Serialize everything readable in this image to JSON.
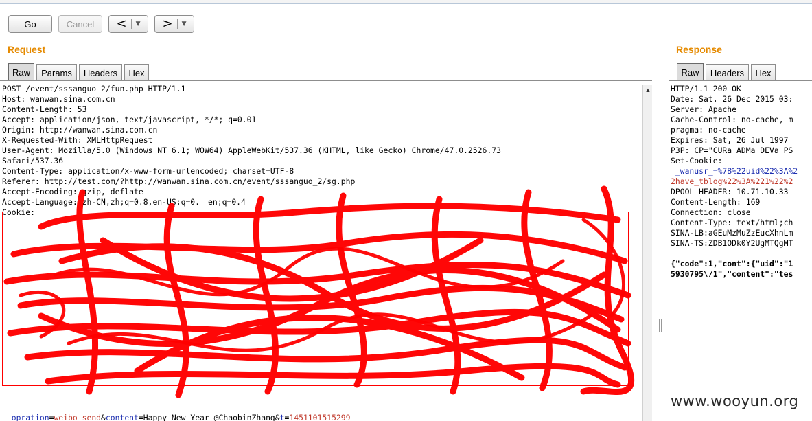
{
  "toolbar": {
    "go_label": "Go",
    "cancel_label": "Cancel",
    "back_arrow": "<",
    "forward_arrow": ">",
    "dropdown_glyph": "▼"
  },
  "request": {
    "title": "Request",
    "tabs": [
      "Raw",
      "Params",
      "Headers",
      "Hex"
    ],
    "lines": [
      "POST /event/sssanguo_2/fun.php HTTP/1.1",
      "Host: wanwan.sina.com.cn",
      "Content-Length: 53",
      "Accept: application/json, text/javascript, */*; q=0.01",
      "Origin: http://wanwan.sina.com.cn",
      "X-Requested-With: XMLHttpRequest",
      "User-Agent: Mozilla/5.0 (Windows NT 6.1; WOW64) AppleWebKit/537.36 (KHTML, like Gecko) Chrome/47.0.2526.73",
      "Safari/537.36",
      "Content-Type: application/x-www-form-urlencoded; charset=UTF-8",
      "Referer: http://test.com/?http://wanwan.sina.com.cn/event/sssanguo_2/sg.php",
      "Accept-Encoding: gzip, deflate",
      "Accept-Language: zh-CN,zh;q=0.8,en-US;q=0.",
      "Cookie:"
    ],
    "lang_tail": "en;q=0.4",
    "body": {
      "k1": "opration",
      "v1": "weibo_send",
      "k2": "content",
      "v2": "Happy New Year @ChaobinZhang",
      "k3": "t",
      "v3": "1451101515299"
    }
  },
  "response": {
    "title": "Response",
    "tabs": [
      "Raw",
      "Headers",
      "Hex"
    ],
    "lines": [
      "HTTP/1.1 200 OK",
      "Date: Sat, 26 Dec 2015 03:",
      "Server: Apache",
      "Cache-Control: no-cache, m",
      "pragma: no-cache",
      "Expires: Sat, 26 Jul 1997",
      "P3P: CP=\"CURa ADMa DEVa PS",
      "Set-Cookie:",
      " _wanusr_=%7B%22uid%22%3A%2",
      "2have_tblog%22%3A%221%22%2",
      "DPOOL_HEADER: 10.71.10.33",
      "Content-Length: 169",
      "Connection: close",
      "Content-Type: text/html;ch",
      "SINA-LB:aGEuMzMuZzEucXhnLm",
      "SINA-TS:ZDB1ODk0Y2UgMTQgMT"
    ],
    "json_lines": [
      "{\"code\":1,\"cont\":{\"uid\":\"1",
      "5930795\\/1\",\"content\":\"tes"
    ]
  },
  "watermark": "www.wooyun.org",
  "colors": {
    "accent": "#e58a00",
    "redaction": "#ff0000"
  }
}
